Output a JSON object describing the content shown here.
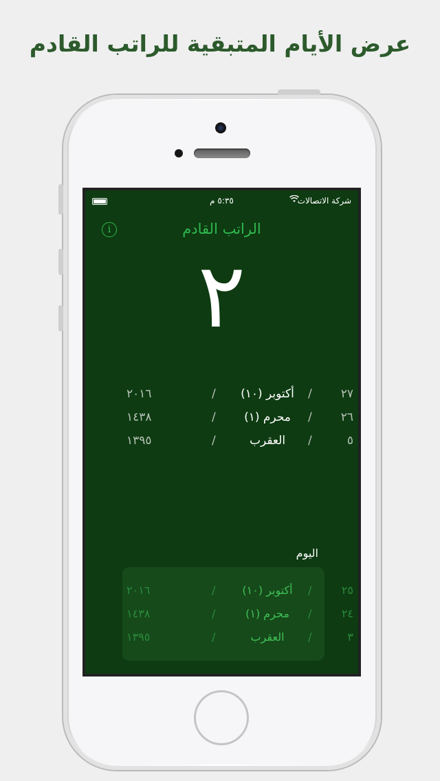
{
  "headline": "عرض الأيام المتبقية للراتب القادم",
  "status_bar": {
    "carrier": "شركة الاتصالات",
    "time": "٥:٣٥ م"
  },
  "app": {
    "title": "الراتب القادم",
    "info_icon": "i",
    "days_remaining": "٢",
    "next_payday": [
      {
        "day": "٢٧",
        "month": "أكتوبر (١٠)",
        "year": "٢٠١٦"
      },
      {
        "day": "٢٦",
        "month": "محرم (١)",
        "year": "١٤٣٨"
      },
      {
        "day": "٥",
        "month": "العقرب",
        "year": "١٣٩٥"
      }
    ],
    "today_label": "اليوم",
    "today": [
      {
        "day": "٢٥",
        "month": "أكتوبر (١٠)",
        "year": "٢٠١٦"
      },
      {
        "day": "٢٤",
        "month": "محرم (١)",
        "year": "١٤٣٨"
      },
      {
        "day": "٣",
        "month": "العقرب",
        "year": "١٣٩٥"
      }
    ],
    "separator": "/"
  },
  "colors": {
    "screen_bg": "#0e3b12",
    "accent_green": "#2fb94f",
    "headline": "#2c5a2c"
  },
  "icons": [
    "info-icon",
    "wifi-icon",
    "battery-icon"
  ]
}
